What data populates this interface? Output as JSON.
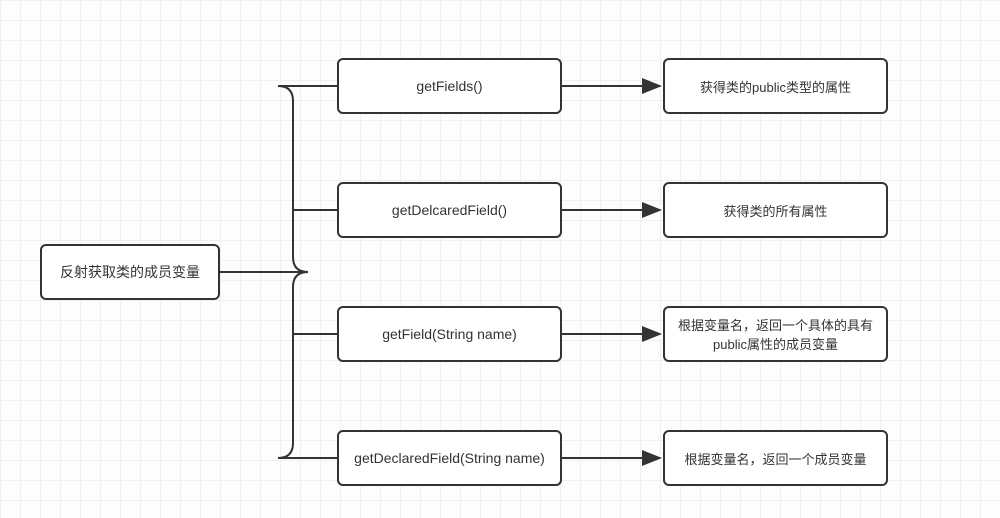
{
  "root": {
    "label": "反射获取类的成员变量"
  },
  "methods": [
    {
      "name": "getFields()",
      "description": "获得类的public类型的属性"
    },
    {
      "name": "getDelcaredField()",
      "description": "获得类的所有属性"
    },
    {
      "name": "getField(String name)",
      "description": "根据变量名，返回一个具体的具有public属性的成员变量"
    },
    {
      "name": "getDeclaredField(String name)",
      "description": "根据变量名，返回一个成员变量"
    }
  ]
}
